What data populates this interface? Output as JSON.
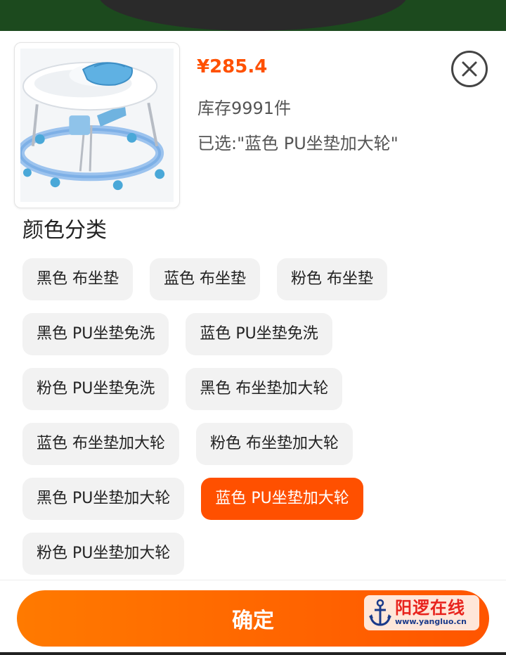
{
  "product": {
    "price": "¥285.4",
    "stock": "库存9991件",
    "selected": "已选:\"蓝色 PU坐垫加大轮\""
  },
  "section_title": "颜色分类",
  "options": [
    [
      "黑色 布坐垫",
      "蓝色 布坐垫",
      "粉色 布坐垫"
    ],
    [
      "黑色 PU坐垫免洗",
      "蓝色 PU坐垫免洗"
    ],
    [
      "粉色 PU坐垫免洗",
      "黑色 布坐垫加大轮"
    ],
    [
      "蓝色 布坐垫加大轮",
      "粉色 布坐垫加大轮"
    ],
    [
      "黑色 PU坐垫加大轮",
      "蓝色 PU坐垫加大轮"
    ],
    [
      "粉色 PU坐垫加大轮"
    ]
  ],
  "active_option": "蓝色 PU坐垫加大轮",
  "confirm_label": "确定",
  "watermark": {
    "cn": "阳逻在线",
    "url": "www.yangluo.cn"
  },
  "colors": {
    "accent": "#ff5000",
    "chip_bg": "#f2f2f2"
  },
  "icons": {
    "close": "close-icon",
    "watermark": "anchor-icon"
  }
}
